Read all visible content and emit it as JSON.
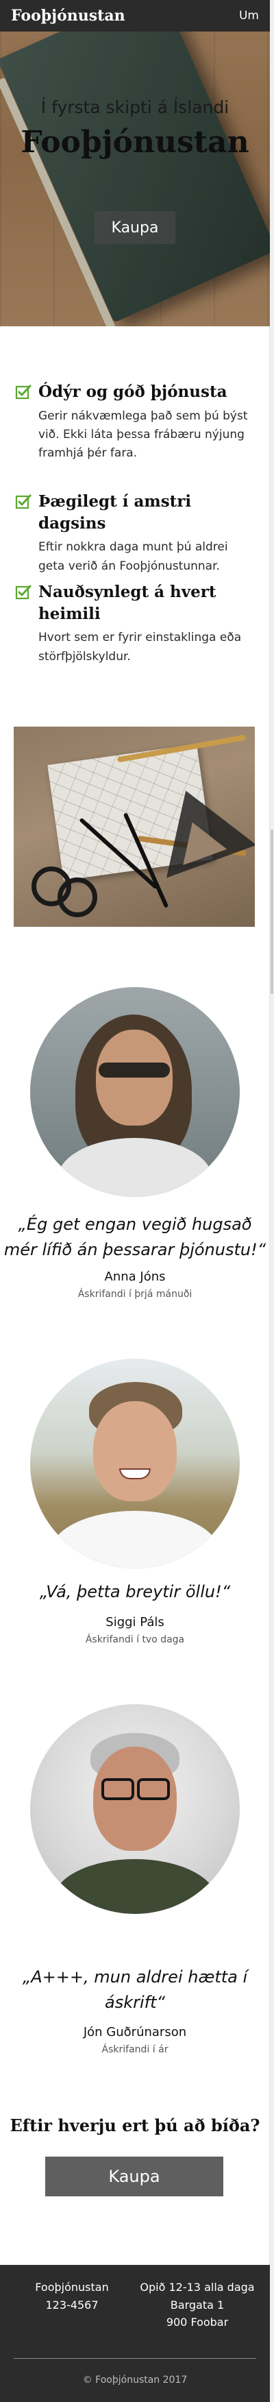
{
  "nav": {
    "brand": "Fooþjónustan",
    "link": "Um"
  },
  "hero": {
    "subtitle": "Í fyrsta skipti á Íslandi",
    "title": "Fooþjónustan",
    "button_label": "Kaupa"
  },
  "features": [
    {
      "icon": "check-icon",
      "title": "Ódýr og góð þjónusta",
      "text": "Gerir nákvæmlega það sem þú býst við. Ekki láta þessa frábæru nýjung framhjá þér fara."
    },
    {
      "icon": "check-icon",
      "title": "Þægilegt í amstri dagsins",
      "text": "Eftir nokkra daga munt þú aldrei geta verið án Fooþjónustunnar."
    },
    {
      "icon": "check-icon",
      "title": "Nauðsynlegt á hvert heimili",
      "text": "Hvort sem er fyrir einstaklinga eða störfþjölskyldur."
    }
  ],
  "testimonials": [
    {
      "quote": "„Ég get engan vegið hugsað mér lífið án þessarar þjónustu!“",
      "name": "Anna Jóns",
      "role": "Áskrifandi í þrjá mánuði"
    },
    {
      "quote": "„Vá, þetta breytir öllu!“",
      "name": "Siggi Páls",
      "role": "Áskrifandi í tvo daga"
    },
    {
      "quote": "„A+++, mun aldrei hætta í áskrift“",
      "name": "Jón Guðrúnarson",
      "role": "Áskrifandi í ár"
    }
  ],
  "cta": {
    "heading": "Eftir hverju ert þú að bíða?",
    "button_label": "Kaupa"
  },
  "footer": {
    "company": "Fooþjónustan",
    "phone": "123-4567",
    "hours": "Opið 12-13 alla daga",
    "street": "Bargata 1",
    "postal": "900 Foobar",
    "copyright": "© Fooþjónustan 2017"
  },
  "colors": {
    "nav_bg": "#2b2b2b",
    "check_green": "#5aa832",
    "footer_bg": "#2c2c2c",
    "cta_button_bg": "#5f5f5f"
  }
}
